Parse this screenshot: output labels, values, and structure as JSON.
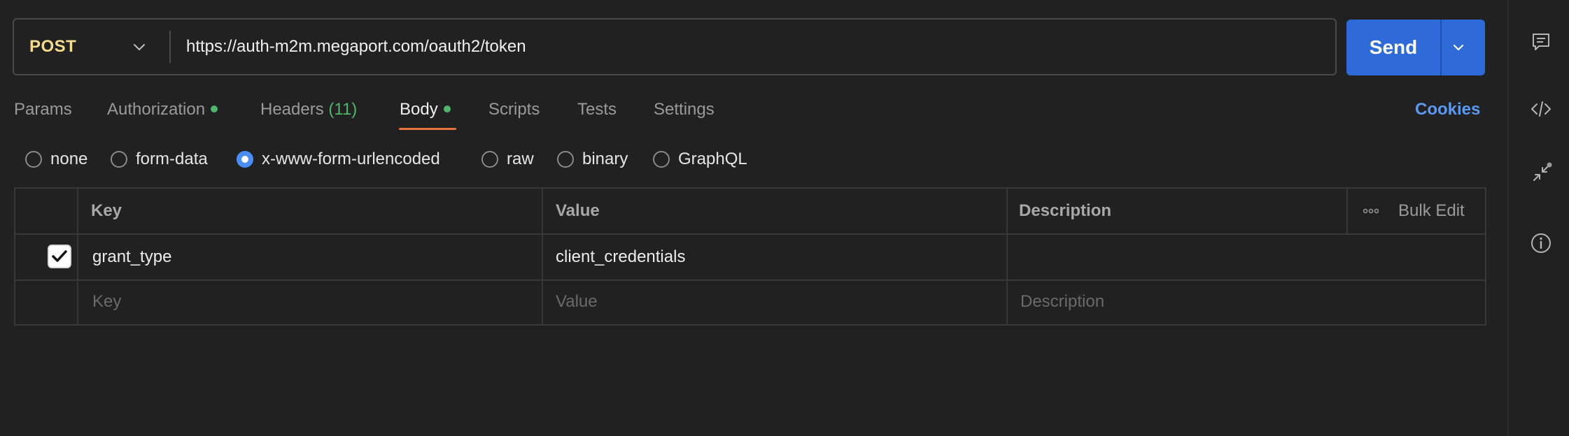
{
  "request": {
    "method": "POST",
    "url": "https://auth-m2m.megaport.com/oauth2/token",
    "send_label": "Send"
  },
  "tabs": [
    {
      "label": "Params"
    },
    {
      "label": "Authorization",
      "indicator": true
    },
    {
      "label": "Headers",
      "count": "(11)"
    },
    {
      "label": "Body",
      "indicator": true,
      "active": true
    },
    {
      "label": "Scripts"
    },
    {
      "label": "Tests"
    },
    {
      "label": "Settings"
    }
  ],
  "cookies_label": "Cookies",
  "body_types": [
    {
      "label": "none",
      "selected": false
    },
    {
      "label": "form-data",
      "selected": false
    },
    {
      "label": "x-www-form-urlencoded",
      "selected": true
    },
    {
      "label": "raw",
      "selected": false
    },
    {
      "label": "binary",
      "selected": false
    },
    {
      "label": "GraphQL",
      "selected": false
    }
  ],
  "table": {
    "headers": {
      "key": "Key",
      "value": "Value",
      "description": "Description"
    },
    "bulk_edit_label": "Bulk Edit",
    "rows": [
      {
        "checked": true,
        "key": "grant_type",
        "value": "client_credentials",
        "description": ""
      }
    ],
    "placeholders": {
      "key": "Key",
      "value": "Value",
      "description": "Description"
    }
  },
  "right_sidebar": {
    "icons": [
      "comments-icon",
      "code-icon",
      "collapse-arrows-icon",
      "info-icon"
    ]
  },
  "colors": {
    "method": "#f4dc8c",
    "send": "#2f6bd8",
    "active_tab_underline": "#e8743b",
    "indicator": "#4fb56a",
    "cookies": "#5a9af0",
    "radio_selected": "#4a8ef5"
  }
}
